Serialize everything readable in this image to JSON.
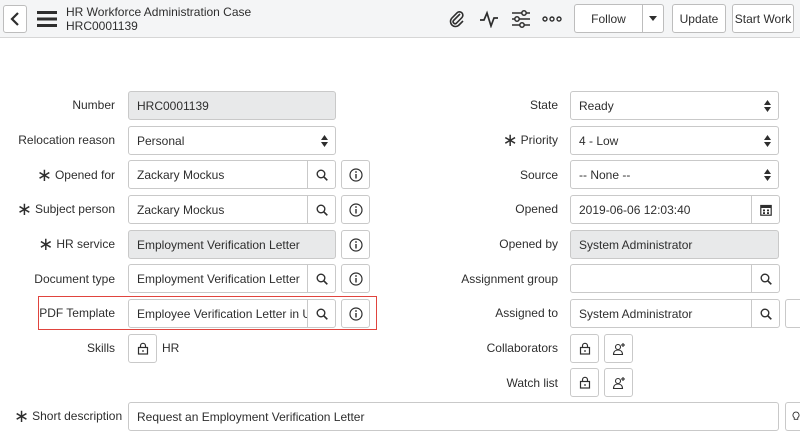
{
  "header": {
    "title": "HR Workforce Administration Case",
    "number": "HRC0001139",
    "follow_label": "Follow",
    "update_label": "Update",
    "start_work_label": "Start Work"
  },
  "form": {
    "number": {
      "label": "Number",
      "value": "HRC0001139"
    },
    "relocation_reason": {
      "label": "Relocation reason",
      "value": "Personal"
    },
    "opened_for": {
      "label": "Opened for",
      "value": "Zackary Mockus"
    },
    "subject_person": {
      "label": "Subject person",
      "value": "Zackary Mockus"
    },
    "hr_service": {
      "label": "HR service",
      "value": "Employment Verification Letter"
    },
    "document_type": {
      "label": "Document type",
      "value": "Employment Verification Letter"
    },
    "pdf_template": {
      "label": "PDF Template",
      "value": "Employee Verification Letter in USA"
    },
    "skills": {
      "label": "Skills",
      "value": "HR"
    },
    "state": {
      "label": "State",
      "value": "Ready"
    },
    "priority": {
      "label": "Priority",
      "value": "4 - Low"
    },
    "source": {
      "label": "Source",
      "value": "-- None --"
    },
    "opened": {
      "label": "Opened",
      "value": "2019-06-06 12:03:40"
    },
    "opened_by": {
      "label": "Opened by",
      "value": "System Administrator"
    },
    "assignment_group": {
      "label": "Assignment group",
      "value": ""
    },
    "assigned_to": {
      "label": "Assigned to",
      "value": "System Administrator"
    },
    "collaborators": {
      "label": "Collaborators"
    },
    "watch_list": {
      "label": "Watch list"
    },
    "short_description": {
      "label": "Short description",
      "value": "Request an Employment Verification Letter"
    }
  },
  "colors": {
    "highlight": "#e0443e",
    "header_bg": "#f4f5f6",
    "readonly_bg": "#e8e9ea"
  }
}
